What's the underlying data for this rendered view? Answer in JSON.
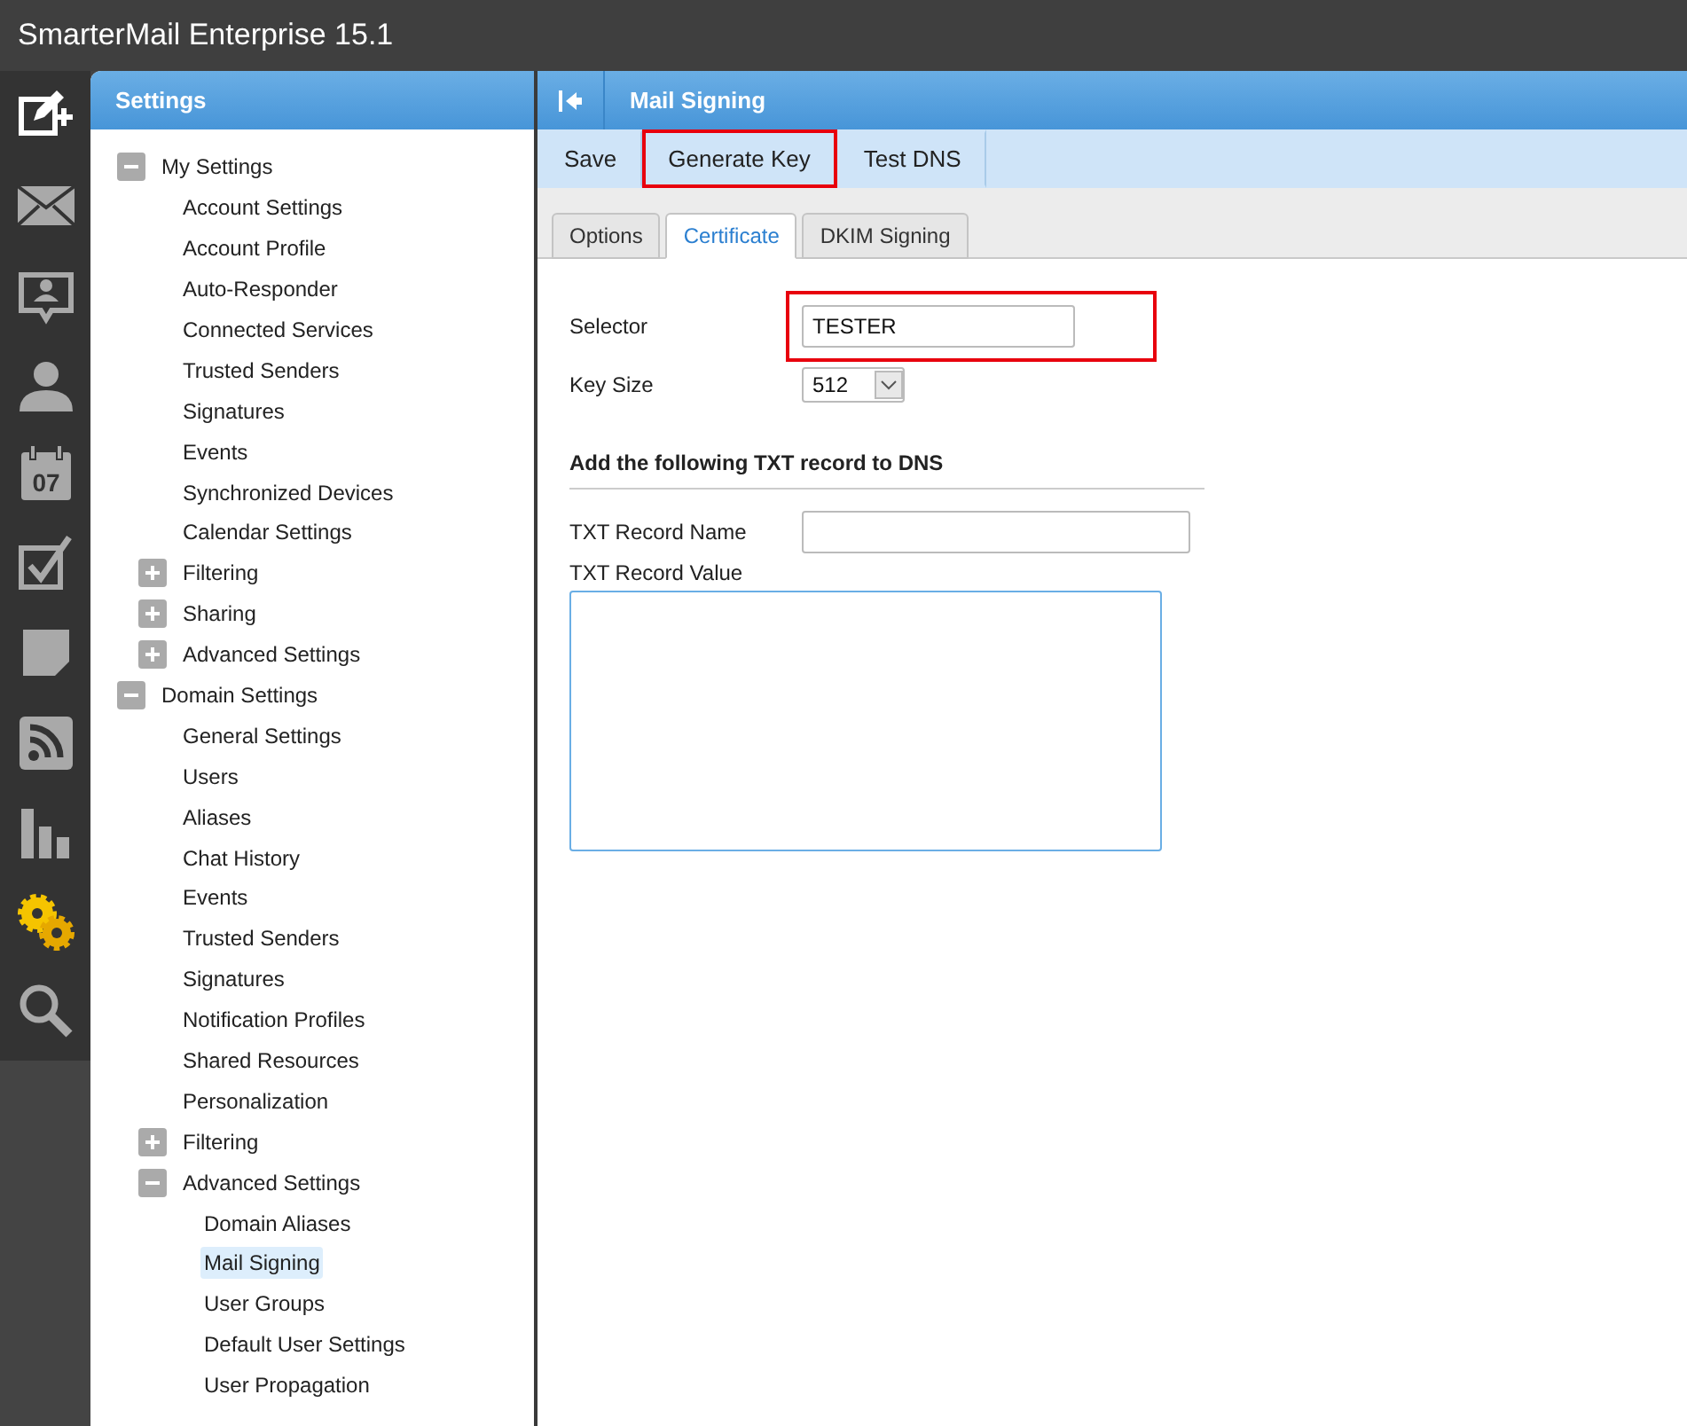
{
  "window": {
    "title": "SmarterMail Enterprise 15.1"
  },
  "rail": [
    {
      "kind": "compose",
      "selected": false
    },
    {
      "kind": "mail",
      "selected": false
    },
    {
      "kind": "chat",
      "selected": false
    },
    {
      "kind": "contacts",
      "selected": false
    },
    {
      "kind": "calendar",
      "day": "07",
      "selected": false
    },
    {
      "kind": "tasks",
      "selected": false
    },
    {
      "kind": "notes",
      "selected": false
    },
    {
      "kind": "feeds",
      "selected": false
    },
    {
      "kind": "reports",
      "selected": false
    },
    {
      "kind": "settings",
      "selected": true
    },
    {
      "kind": "search",
      "selected": false
    }
  ],
  "sidebar": {
    "title": "Settings",
    "items": [
      {
        "kind": "group",
        "label": "My Settings",
        "expanded": true,
        "children": [
          {
            "kind": "page",
            "label": "Account Settings",
            "selected": false
          },
          {
            "kind": "page",
            "label": "Account Profile",
            "selected": false
          },
          {
            "kind": "page",
            "label": "Auto-Responder",
            "selected": false
          },
          {
            "kind": "page",
            "label": "Connected Services",
            "selected": false
          },
          {
            "kind": "page",
            "label": "Trusted Senders",
            "selected": false
          },
          {
            "kind": "page",
            "label": "Signatures",
            "selected": false
          },
          {
            "kind": "page",
            "label": "Events",
            "selected": false
          },
          {
            "kind": "page",
            "label": "Synchronized Devices",
            "selected": false
          },
          {
            "kind": "page",
            "label": "Calendar Settings",
            "selected": false
          },
          {
            "kind": "group",
            "label": "Filtering",
            "expanded": false
          },
          {
            "kind": "group",
            "label": "Sharing",
            "expanded": false
          },
          {
            "kind": "group",
            "label": "Advanced Settings",
            "expanded": false
          }
        ]
      },
      {
        "kind": "group",
        "label": "Domain Settings",
        "expanded": true,
        "children": [
          {
            "kind": "page",
            "label": "General Settings",
            "selected": false
          },
          {
            "kind": "page",
            "label": "Users",
            "selected": false
          },
          {
            "kind": "page",
            "label": "Aliases",
            "selected": false
          },
          {
            "kind": "page",
            "label": "Chat History",
            "selected": false
          },
          {
            "kind": "page",
            "label": "Events",
            "selected": false
          },
          {
            "kind": "page",
            "label": "Trusted Senders",
            "selected": false
          },
          {
            "kind": "page",
            "label": "Signatures",
            "selected": false
          },
          {
            "kind": "page",
            "label": "Notification Profiles",
            "selected": false
          },
          {
            "kind": "page",
            "label": "Shared Resources",
            "selected": false
          },
          {
            "kind": "page",
            "label": "Personalization",
            "selected": false
          },
          {
            "kind": "group",
            "label": "Filtering",
            "expanded": false
          },
          {
            "kind": "group",
            "label": "Advanced Settings",
            "expanded": true,
            "children": [
              {
                "kind": "page",
                "label": "Domain Aliases",
                "selected": false
              },
              {
                "kind": "page",
                "label": "Mail Signing",
                "selected": true
              },
              {
                "kind": "page",
                "label": "User Groups",
                "selected": false
              },
              {
                "kind": "page",
                "label": "Default User Settings",
                "selected": false
              },
              {
                "kind": "page",
                "label": "User Propagation",
                "selected": false
              }
            ]
          }
        ]
      }
    ]
  },
  "main": {
    "title": "Mail Signing",
    "toolbar": [
      {
        "label": "Save",
        "highlighted": false
      },
      {
        "label": "Generate Key",
        "highlighted": true
      },
      {
        "label": "Test DNS",
        "highlighted": false
      }
    ],
    "tabs": [
      {
        "label": "Options",
        "selected": false
      },
      {
        "label": "Certificate",
        "selected": true
      },
      {
        "label": "DKIM Signing",
        "selected": false
      }
    ],
    "selector": {
      "label": "Selector",
      "value": "TESTER",
      "highlighted": true
    },
    "key_size": {
      "label": "Key Size",
      "value": "512"
    },
    "section_heading": "Add the following TXT record to DNS",
    "txt_record_name": {
      "label": "TXT Record Name"
    },
    "txt_record_value": {
      "label": "TXT Record Value"
    }
  }
}
